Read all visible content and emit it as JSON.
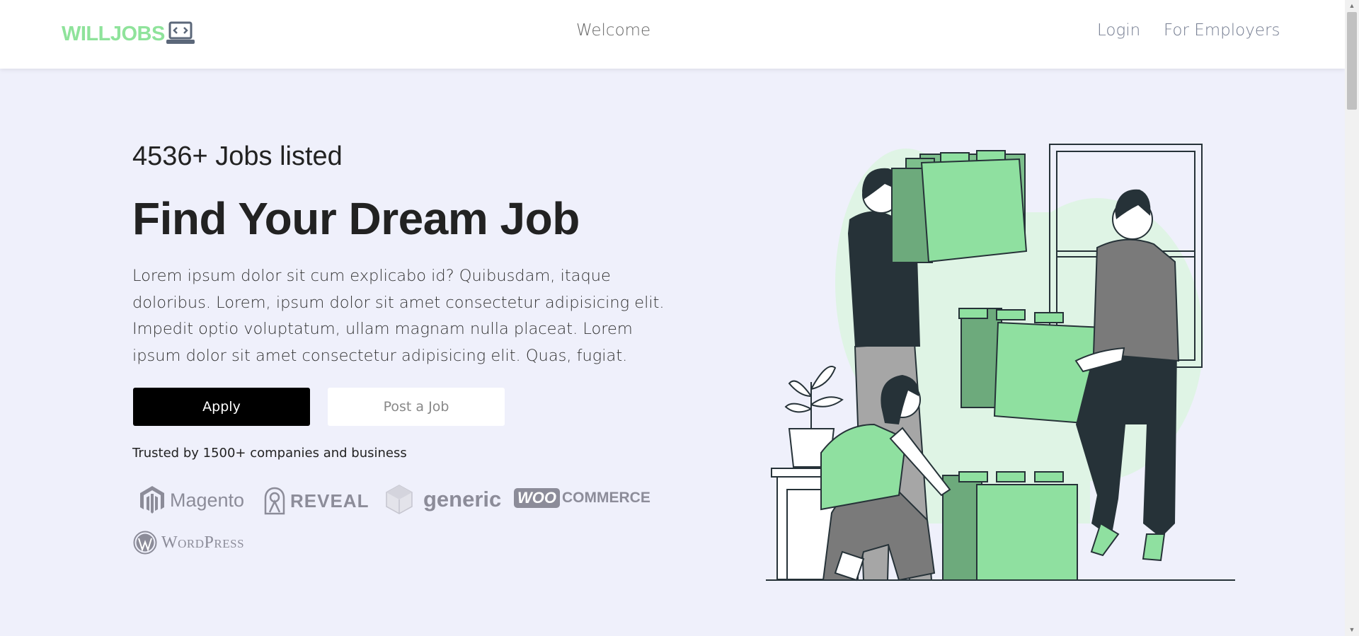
{
  "navbar": {
    "logo_text": "WILLJOBS",
    "center_link": "Welcome",
    "login": "Login",
    "for_employers": "For Employers"
  },
  "hero": {
    "jobs_count": "4536+ Jobs listed",
    "headline": "Find Your Dream Job",
    "description": "Lorem ipsum dolor sit cum explicabo id? Quibusdam, itaque doloribus. Lorem, ipsum dolor sit amet consectetur adipisicing elit. Impedit optio voluptatum, ullam magnam nulla placeat. Lorem ipsum dolor sit amet consectetur adipisicing elit. Quas, fugiat.",
    "apply_label": "Apply",
    "post_job_label": "Post a Job",
    "trusted_text": "Trusted by 1500+ companies and business"
  },
  "partners": [
    {
      "name": "Magento",
      "icon": "magento-icon"
    },
    {
      "name": "REVEAL",
      "icon": "reveal-icon"
    },
    {
      "name": "generic",
      "icon": "generic-cube-icon"
    },
    {
      "name_box": "WOO",
      "name": "COMMERCE",
      "icon": "woocommerce-logo"
    },
    {
      "name": "WordPress",
      "icon": "wordpress-icon"
    }
  ],
  "colors": {
    "brand": "#8fe39b",
    "background": "#eff0fb",
    "illustration_green": "#8fe0a0",
    "illustration_dark": "#263238"
  }
}
